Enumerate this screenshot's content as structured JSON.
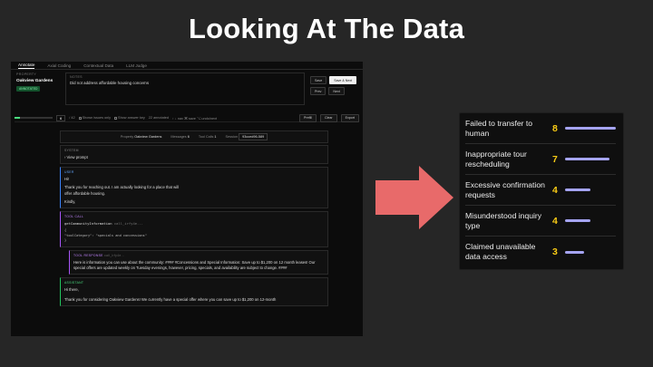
{
  "slide": {
    "title": "Looking At The Data"
  },
  "app": {
    "tabs": [
      {
        "label": "Annotate",
        "active": true
      },
      {
        "label": "Axial Coding",
        "active": false
      },
      {
        "label": "Contextual Data",
        "active": false
      },
      {
        "label": "LLM Judge",
        "active": false
      }
    ],
    "property": {
      "label": "PROPERTY",
      "name": "Oakview Gardens",
      "status": "ANNOTATED"
    },
    "notes": {
      "label": "NOTES",
      "text": "Did not address affordable housing concerns"
    },
    "buttons": {
      "save": "Save",
      "save_next": "Save & Next",
      "prev": "Prev",
      "next": "Next"
    },
    "progress": {
      "fraction": 0.15,
      "current": "6",
      "total": "/ 42",
      "shown_only": "Shown issues only",
      "show_answer": "Show answer key",
      "annotated": "22 annotated",
      "keys": "↑ ↓ nav  ⌘ save  ⌥ undo/next",
      "buttons": [
        "Prefill",
        "Clear",
        "Export"
      ]
    },
    "meta": {
      "property_label": "Property",
      "property_value": "Oakview Gardens",
      "messages_label": "Messages",
      "messages_value": "6",
      "tool_calls_label": "Tool Calls",
      "tool_calls_value": "1",
      "session_label": "Session",
      "session_value": "93cced96-589"
    },
    "messages": {
      "system": {
        "role": "SYSTEM",
        "text": "› View prompt"
      },
      "user": {
        "role": "USER",
        "lines": [
          "Hi!",
          "Thank you for reaching out. I am actually looking for a place that will",
          "offer affordable housing.",
          "Kindly,"
        ]
      },
      "tool_call": {
        "role": "TOOL CALL",
        "fn": "getCommunityInformation",
        "fn_sub": "call_irfy4e...",
        "code": [
          "{",
          "  \"toolCategory\": \"specials and concessions\"",
          "}"
        ]
      },
      "tool_response": {
        "role": "TOOL RESPONSE",
        "role_sub": "call_irfy4e...",
        "text": "Here is information you can use about the community: #### #Concessions and Special Information: Save up to $1,200 on 12 month leases! Our special offers are updated weekly on Tuesday evenings, however, pricing, specials, and availability are subject to change. ####"
      },
      "assistant": {
        "role": "ASSISTANT",
        "lines": [
          "Hi there,",
          "Thank you for considering Oakview Gardens! We currently have a special offer where you can save up to $1,200 on 12-month"
        ]
      }
    }
  },
  "arrow": {
    "color": "#e86a6a"
  },
  "failure_modes": {
    "max": 8,
    "items": [
      {
        "label": "Failed to transfer to human",
        "count": 8
      },
      {
        "label": "Inappropriate tour rescheduling",
        "count": 7
      },
      {
        "label": "Excessive confirmation requests",
        "count": 4
      },
      {
        "label": "Misunderstood inquiry type",
        "count": 4
      },
      {
        "label": "Claimed unavailable data access",
        "count": 3
      }
    ],
    "count_color": "#facc15",
    "bar_color": "#a5a4f3"
  }
}
